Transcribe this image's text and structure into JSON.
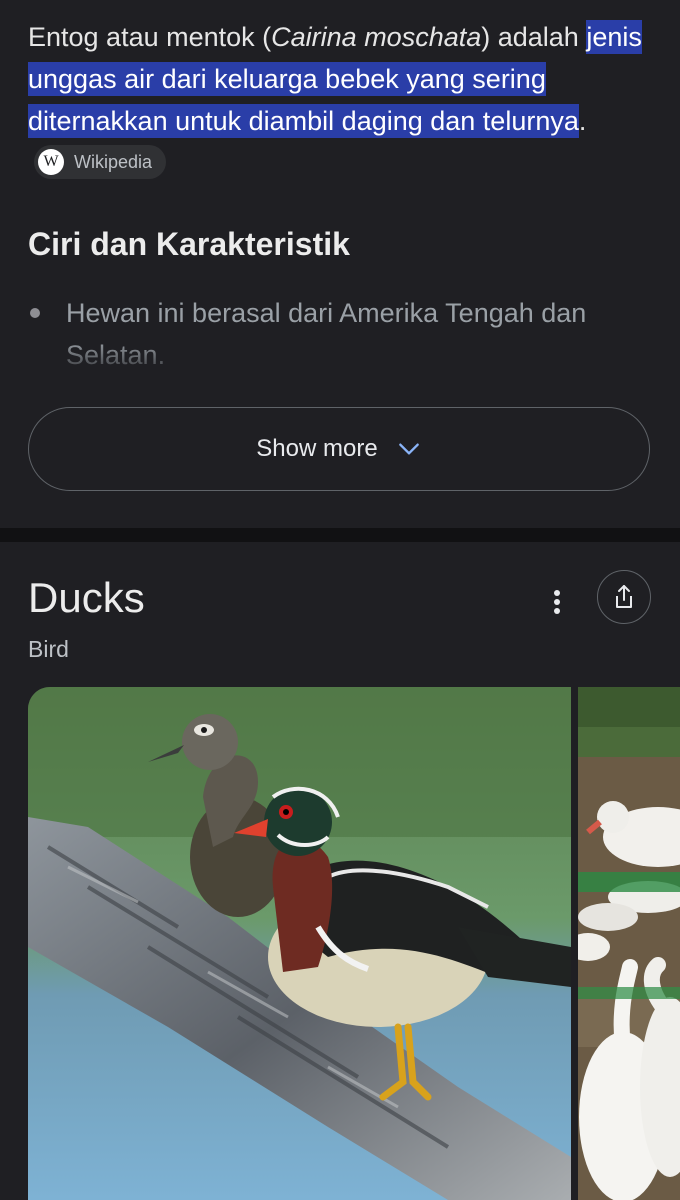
{
  "snippet": {
    "lead_plain": "Entog atau mentok (",
    "lead_italic": "Cairina moschata",
    "lead_after": ") adalah ",
    "highlight": "jenis unggas air dari keluarga bebek yang sering diternakkan untuk diambil daging dan telurnya",
    "end": ".",
    "source": {
      "logo_letter": "W",
      "name": "Wikipedia",
      "icon": "wikipedia-logo-icon"
    }
  },
  "section": {
    "heading": "Ciri dan Karakteristik",
    "bullets": [
      "Hewan ini berasal dari Amerika Tengah dan Selatan."
    ]
  },
  "show_more": {
    "label": "Show more",
    "icon": "chevron-down-icon"
  },
  "entity": {
    "title": "Ducks",
    "subtitle": "Bird",
    "more_icon": "more-vert-icon",
    "share_icon": "share-icon",
    "images": [
      {
        "subject": "wood-duck-pair-on-log"
      },
      {
        "subject": "white-muscovy-ducks-group"
      }
    ]
  },
  "colors": {
    "background": "#1f1f23",
    "highlight": "#2a3ea8",
    "divider": "#111113",
    "accent": "#8ab4f8"
  }
}
